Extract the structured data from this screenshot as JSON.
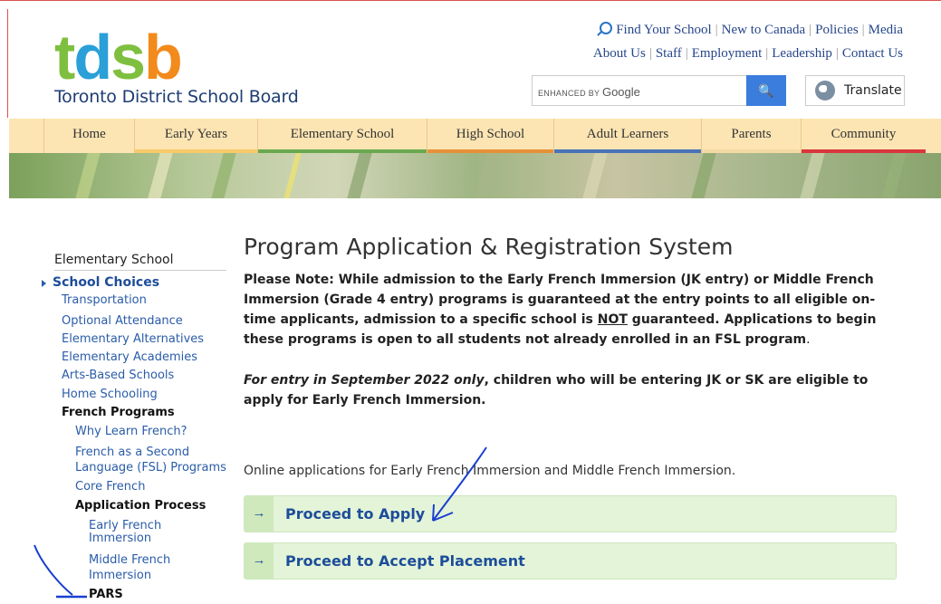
{
  "logo": {
    "mark_t": "t",
    "mark_d": "d",
    "mark_s": "s",
    "mark_b": "b",
    "subtitle": "Toronto District School Board"
  },
  "toplinks": {
    "row1": [
      "Find Your School",
      "New to Canada",
      "Policies",
      "Media"
    ],
    "row2": [
      "About Us",
      "Staff",
      "Employment",
      "Leadership",
      "Contact Us"
    ]
  },
  "search": {
    "enhanced": "ENHANCED BY",
    "google": "Google",
    "button": "🔍"
  },
  "translate": {
    "label": "Translate"
  },
  "nav": [
    {
      "label": "Home",
      "color": "#fde5b3"
    },
    {
      "label": "Early Years",
      "color": "#f7c96a"
    },
    {
      "label": "Elementary School",
      "color": "#6aa84f"
    },
    {
      "label": "High School",
      "color": "#e69138"
    },
    {
      "label": "Adult Learners",
      "color": "#4a72b8"
    },
    {
      "label": "Parents",
      "color": "#f3d9a4"
    },
    {
      "label": "Community",
      "color": "#d9363e"
    }
  ],
  "sidebar": {
    "title": "Elementary School",
    "items": [
      "School Choices",
      "Transportation",
      "Optional Attendance",
      "Elementary Alternatives",
      "Elementary Academies",
      "Arts-Based Schools",
      "Home Schooling",
      "French Programs",
      "Why Learn French?",
      "French as a Second",
      "Language (FSL) Programs",
      "Core French",
      "Application Process",
      "Early French",
      "Immersion",
      "Middle French",
      "Immersion",
      "PARS"
    ]
  },
  "main": {
    "title": "Program Application & Registration System",
    "note_a": "Please Note: While admission to the Early French Immersion (JK entry) or Middle French Immersion (Grade 4 entry) programs is guaranteed at the entry points to all eligible on-time applicants, admission to a specific school is ",
    "note_not": "NOT",
    "note_b": " guaranteed. Applications to begin these programs is open to all students not already enrolled in an FSL program",
    "note_period": ".",
    "entry_italic": "For entry in September 2022 only",
    "entry_rest": ", children who will be entering JK or SK are eligible to apply for Early French Immersion.",
    "online": "Online applications for Early French Immersion and Middle French Immersion.",
    "buttons": [
      {
        "arrow": "→",
        "label": "Proceed to Apply"
      },
      {
        "arrow": "→",
        "label": "Proceed to Accept Placement"
      }
    ]
  }
}
